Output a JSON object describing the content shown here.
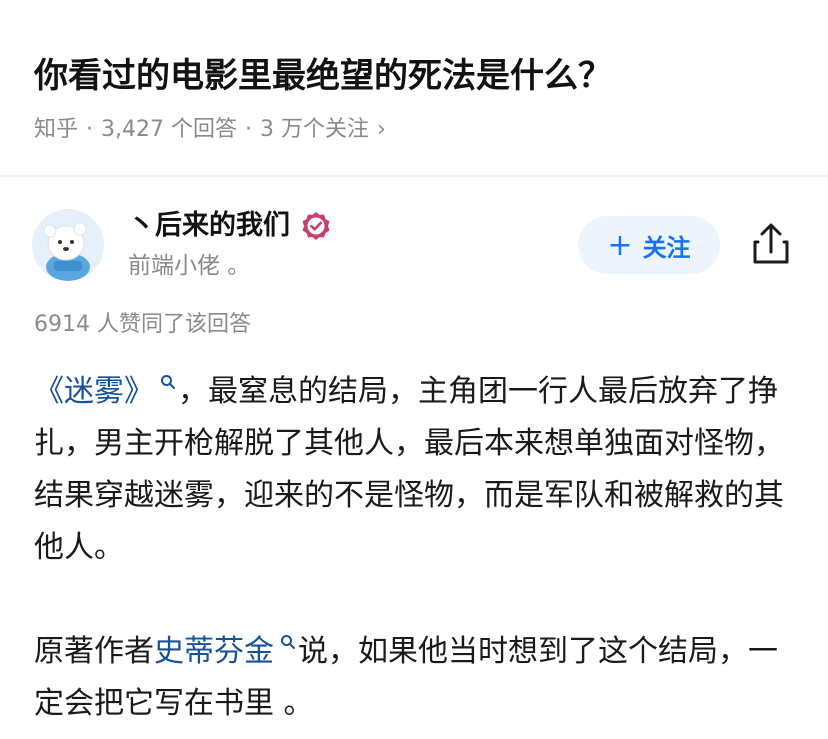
{
  "question": {
    "title": "你看过的电影里最绝望的死法是什么？",
    "source": "知乎",
    "separator": "·",
    "answers_count": "3,427 个回答",
    "followers": "3 万个关注",
    "chevron": "›"
  },
  "author": {
    "name": "丶后来的我们",
    "badge_icon": "verified-badge-icon",
    "bio": "前端小佬 。",
    "follow_label": "关注",
    "follow_plus": "+"
  },
  "answer": {
    "votes_text": "6914 人赞同了该回答",
    "p1_link": "《迷雾》",
    "p1_text": "，最窒息的结局，主角团一行人最后放弃了挣扎，男主开枪解脱了其他人，最后本来想单独面对怪物，结果穿越迷雾，迎来的不是怪物，而是军队和被解救的其他人。",
    "p2_pre": "原著作者",
    "p2_link": "史蒂芬金",
    "p2_text": "说，如果他当时想到了这个结局，一定会把它写在书里 。"
  },
  "colors": {
    "link": "#175199",
    "accent": "#1772f6",
    "muted": "#8a8a8a",
    "badge": "#c8406a"
  }
}
